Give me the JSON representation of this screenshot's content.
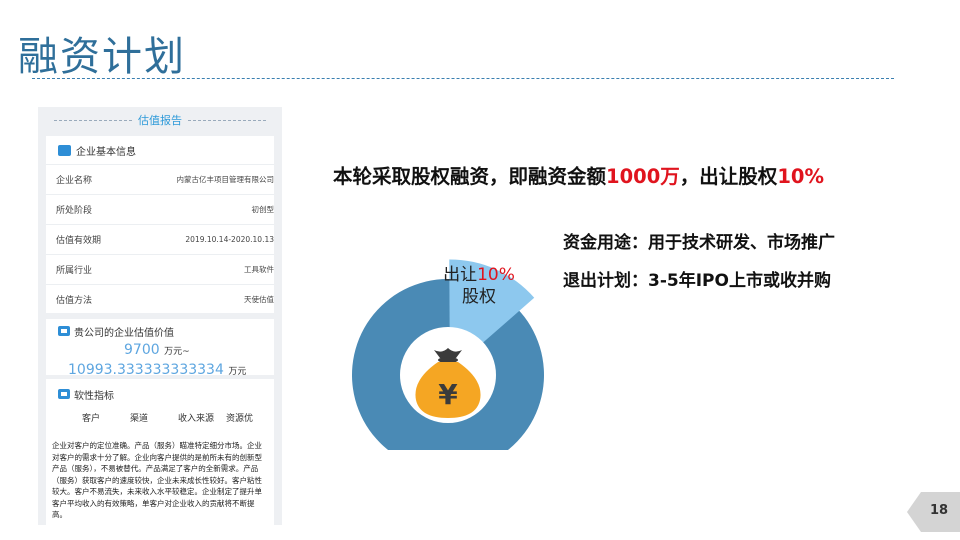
{
  "title": "融资计划",
  "report": {
    "header": "估值报告",
    "basic_info_title": "企业基本信息",
    "rows": [
      {
        "key": "企业名称",
        "value": "内蒙古亿丰项目管理有限公司"
      },
      {
        "key": "所处阶段",
        "value": "初创型"
      },
      {
        "key": "估值有效期",
        "value": "2019.10.14-2020.10.13"
      },
      {
        "key": "所属行业",
        "value": "工具软件"
      },
      {
        "key": "估值方法",
        "value": "天使估值"
      }
    ],
    "valuation_title": "贵公司的企业估值价值",
    "valuation_low": "9700",
    "valuation_low_unit": "万元~",
    "valuation_high": "10993.333333333334",
    "valuation_high_unit": "万元",
    "soft_title": "软性指标",
    "soft_columns": [
      "客户",
      "渠道",
      "收入来源",
      "资源优"
    ],
    "soft_text": "企业对客户的定位准确。产品（服务）瞄准特定细分市场。企业对客户的需求十分了解。企业向客户提供的是前所未有的创新型产品（服务），不易被替代。产品满足了客户的全新需求。产品（服务）获取客户的速度较快，企业未来成长性较好。客户粘性较大。客户不易流失，未来收入水平较稳定。企业制定了提升单客户平均收入的有效策略，单客户对企业收入的贡献将不断提高。"
  },
  "headline": {
    "part1": "本轮采取股权融资，即融资金额",
    "amount": "1000万",
    "part2": "，出让股权",
    "ratio": "10%"
  },
  "bullets": {
    "use": "资金用途：用于技术研发、市场推广",
    "exit": "退出计划：3-5年IPO上市或收并购"
  },
  "pie": {
    "label_prefix": "出让",
    "label_pct": "10%",
    "label_suffix": "股权",
    "icon": "money-bag-icon"
  },
  "chart_data": {
    "type": "pie",
    "categories": [
      "出让股权",
      ""
    ],
    "values": [
      10,
      90
    ],
    "colors": [
      "#8dc8ee",
      "#4a8ab5"
    ]
  },
  "page_number": "18",
  "colors": {
    "title": "#2f6f9a",
    "accent_red": "#e0141e",
    "donut_main": "#4a8ab5",
    "donut_slice": "#8dc8ee",
    "coin": "#f5a623"
  }
}
